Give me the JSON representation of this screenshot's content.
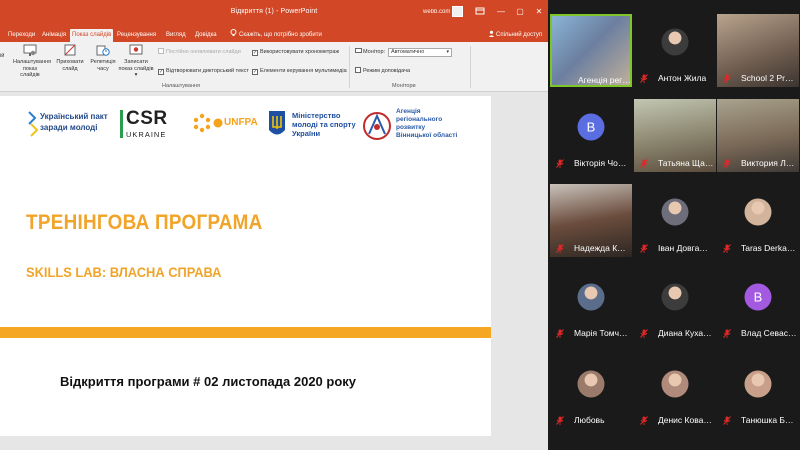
{
  "window": {
    "title": "Відкриття (1)  -  PowerPoint",
    "user": "webb.com"
  },
  "window_controls": [
    "—",
    "▢",
    "✕"
  ],
  "tabs": [
    {
      "label": "Переходи",
      "active": false
    },
    {
      "label": "Анімація",
      "active": false
    },
    {
      "label": "Показ слайдів",
      "active": true
    },
    {
      "label": "Рецензування",
      "active": false
    },
    {
      "label": "Вигляд",
      "active": false
    },
    {
      "label": "Довідка",
      "active": false
    }
  ],
  "tell_me": "Скажіть, що потрібно зробити",
  "share_label": "Спільний доступ",
  "ribbon": {
    "partial_label": "ій",
    "buttons": [
      {
        "label": "Налаштування показ слайдів",
        "icon": "setup-show-icon"
      },
      {
        "label": "Приховати слайд",
        "icon": "hide-slide-icon"
      },
      {
        "label": "Репетиція часу",
        "icon": "rehearse-timings-icon"
      },
      {
        "label": "Записати показ слайдів ▾",
        "icon": "record-show-icon"
      }
    ],
    "checkboxes_left": [
      {
        "label": "Постійно оновлювати слайди",
        "checked": false,
        "disabled": true
      },
      {
        "label": "Відтворювати дикторський текст",
        "checked": true,
        "disabled": false
      }
    ],
    "checkboxes_right": [
      {
        "label": "Використовувати хронометраж",
        "checked": true,
        "disabled": false
      },
      {
        "label": "Елементи керування мультимедіа",
        "checked": true,
        "disabled": false
      }
    ],
    "group_setup": "Налаштування",
    "monitor_label": "Монітор:",
    "monitor_value": "Автоматично",
    "presenter_view": "Режим доповідача",
    "group_monitors": "Монітори"
  },
  "slide": {
    "logos": {
      "pact_line1": "Український пакт",
      "pact_line2": "заради молоді",
      "csr_line1": "CSR",
      "csr_line2": "UKRAINE",
      "unfpa": "UNFPA",
      "ministry_line1": "Міністерство",
      "ministry_line2": "молоді та спорту",
      "ministry_line3": "України",
      "agency_line1": "Агенція",
      "agency_line2": "регіонального",
      "agency_line3": "розвитку",
      "agency_line4": "Вінницької області"
    },
    "title": "ТРЕНІНГОВА ПРОГРАМА",
    "subtitle": "SKILLS LAB: ВЛАСНА СПРАВА",
    "footer": "Відкриття програми   #   02 листопада  2020 року"
  },
  "participants": [
    {
      "name": "Агенція рег…",
      "type": "video",
      "highlighted": true,
      "muted": false
    },
    {
      "name": "Антон Жила",
      "type": "photo",
      "muted": true
    },
    {
      "name": "School 2 Pr…",
      "type": "video",
      "muted": true
    },
    {
      "name": "Вікторія Чо…",
      "type": "initial",
      "initial": "В",
      "color": "#5b6ee1",
      "muted": true
    },
    {
      "name": "Татьяна Ща…",
      "type": "video",
      "muted": true
    },
    {
      "name": "Виктория Л…",
      "type": "video",
      "muted": true
    },
    {
      "name": "Надежда К…",
      "type": "video",
      "muted": true
    },
    {
      "name": "Іван Довга…",
      "type": "photo",
      "muted": true
    },
    {
      "name": "Taras Derka…",
      "type": "photo",
      "muted": true
    },
    {
      "name": "Марія Томч…",
      "type": "photo",
      "muted": true
    },
    {
      "name": "Диана Куха…",
      "type": "photo",
      "muted": true
    },
    {
      "name": "Влад Севас…",
      "type": "initial",
      "initial": "В",
      "color": "#a35ae0",
      "muted": true
    },
    {
      "name": "Любовь",
      "type": "photo",
      "muted": true
    },
    {
      "name": "Денис Кова…",
      "type": "photo",
      "muted": true
    },
    {
      "name": "Танюшка Б…",
      "type": "photo",
      "muted": true
    }
  ],
  "colors": {
    "ppt_accent": "#d24726",
    "slide_orange": "#f0a429",
    "mic_muted": "#e02828"
  }
}
